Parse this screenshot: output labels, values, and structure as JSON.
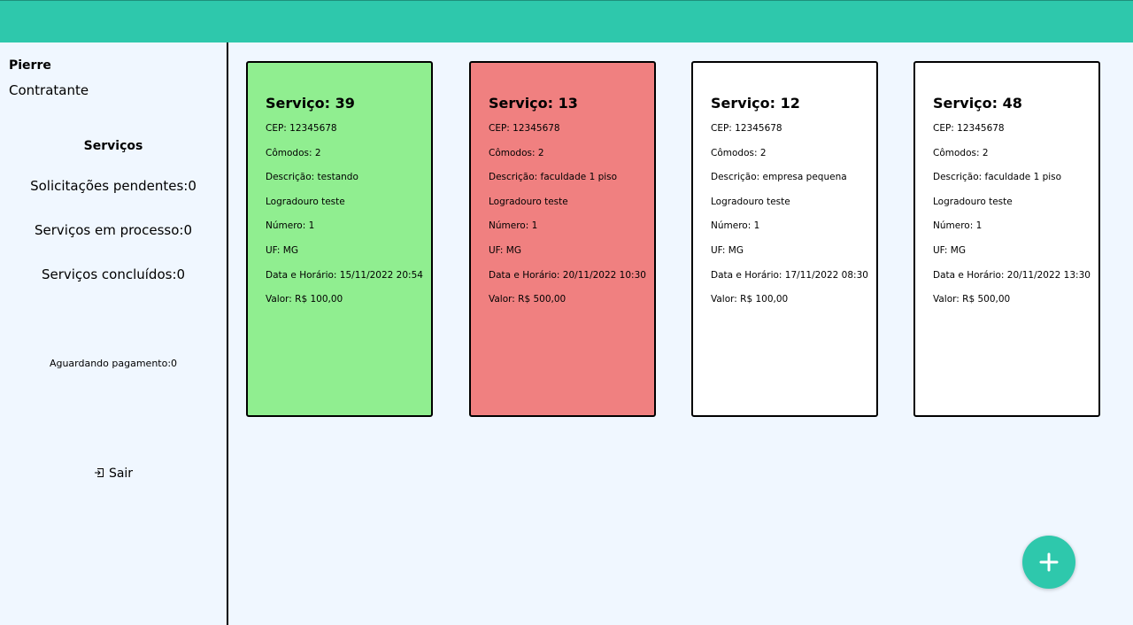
{
  "colors": {
    "header": "#2ec8ac",
    "background": "#f0f7ff",
    "accepted_card": "#90ee90",
    "rejected_card": "#f08080",
    "pending_card": "#ffffff"
  },
  "user": {
    "name": "Pierre",
    "role": "Contratante"
  },
  "sidebar": {
    "heading": "Serviços",
    "stats": [
      "Solicitações pendentes:0",
      "Serviços em processo:0",
      "Serviços concluídos:0"
    ],
    "awaiting_payment": "Aguardando pagamento:0",
    "logout_label": "Sair",
    "logout_icon": "logout-icon"
  },
  "cards": [
    {
      "title": "Serviço: 39",
      "color": "#90ee90",
      "cep": "CEP: 12345678",
      "comodos": "Cômodos: 2",
      "descricao": "Descrição: testando",
      "logradouro": "Logradouro teste",
      "numero": "Número: 1",
      "uf": "UF: MG",
      "data": "Data e Horário: 15/11/2022 20:54",
      "valor": "Valor: R$ 100,00"
    },
    {
      "title": "Serviço: 13",
      "color": "#f08080",
      "cep": "CEP: 12345678",
      "comodos": "Cômodos: 2",
      "descricao": "Descrição: faculdade 1 piso",
      "logradouro": "Logradouro teste",
      "numero": "Número: 1",
      "uf": "UF: MG",
      "data": "Data e Horário: 20/11/2022 10:30",
      "valor": "Valor: R$ 500,00"
    },
    {
      "title": "Serviço: 12",
      "color": "#ffffff",
      "cep": "CEP: 12345678",
      "comodos": "Cômodos: 2",
      "descricao": "Descrição: empresa pequena",
      "logradouro": "Logradouro teste",
      "numero": "Número: 1",
      "uf": "UF: MG",
      "data": "Data e Horário: 17/11/2022 08:30",
      "valor": "Valor: R$ 100,00"
    },
    {
      "title": "Serviço: 48",
      "color": "#ffffff",
      "cep": "CEP: 12345678",
      "comodos": "Cômodos: 2",
      "descricao": "Descrição: faculdade 1 piso",
      "logradouro": "Logradouro teste",
      "numero": "Número: 1",
      "uf": "UF: MG",
      "data": "Data e Horário: 20/11/2022 13:30",
      "valor": "Valor: R$ 500,00"
    }
  ],
  "fab": {
    "icon": "plus-icon"
  }
}
